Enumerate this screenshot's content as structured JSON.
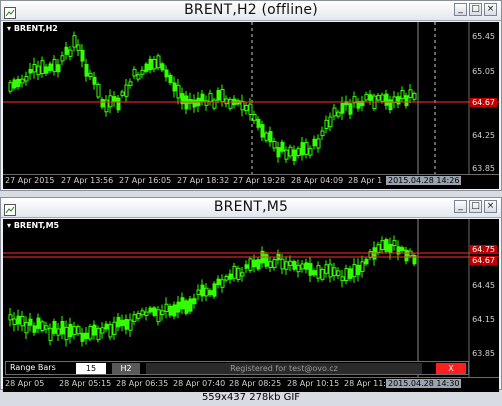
{
  "top_window": {
    "title": "BRENT,H2 (offline)",
    "symbol_label": "BRENT,H2",
    "current_price": "64.67",
    "price_labels": [
      "65.45",
      "65.05",
      "64.25",
      "63.85"
    ],
    "time_labels": [
      "27 Apr 2015",
      "27 Apr 13:56",
      "27 Apr 16:05",
      "27 Apr 18:32",
      "27 Apr 19:28",
      "28 Apr 04:09",
      "28 Apr 1"
    ],
    "cursor_time": "2015.04.28 14:26",
    "candle_color": "#33ff00",
    "bid_line_color": "#ff2b2b",
    "background": "#000000"
  },
  "bottom_window": {
    "title": "BRENT,M5",
    "symbol_label": "BRENT,M5",
    "current_price": "64.67",
    "price_labels": [
      "64.75",
      "64.45",
      "64.15",
      "63.85"
    ],
    "time_labels": [
      "28 Apr 05",
      "28 Apr 05:15",
      "28 Apr 06:35",
      "28 Apr 07:40",
      "28 Apr 08:25",
      "28 Apr 10:15",
      "28 Apr 11:10",
      "28 Apr 13:10"
    ],
    "cursor_time": "2015.04.28 14:30",
    "candle_color": "#33ff00",
    "bid_line_color": "#ff2b2b"
  },
  "range_bars": {
    "label": "Range Bars",
    "value": "15",
    "timeframe": "H2",
    "registered": "Registered for test@ovo.cz",
    "close_label": "X"
  },
  "status": {
    "text": "559x437  278kb  GIF"
  },
  "window_buttons": {
    "minimize": "_",
    "maximize": "□",
    "close": "×"
  }
}
